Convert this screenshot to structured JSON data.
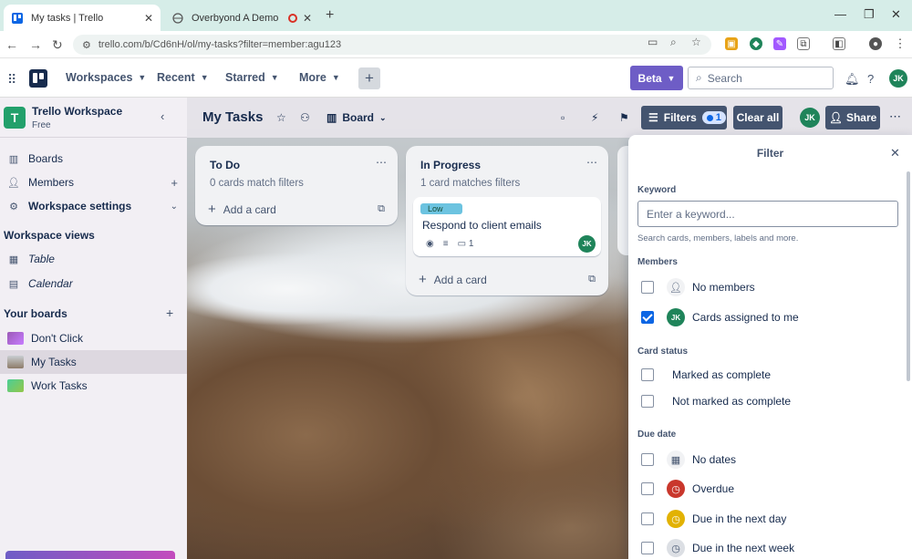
{
  "browser": {
    "tabs": [
      {
        "title": "My tasks | Trello",
        "active": true
      },
      {
        "title": "Overbyond A Demo",
        "active": false
      }
    ],
    "url_prefix": "trello.com",
    "url_path": "/b/Cd6nH/ol/my-tasks?filter=member:agu123"
  },
  "header": {
    "menus": [
      "Workspaces",
      "Recent",
      "Starred",
      "More"
    ],
    "beta_label": "Beta",
    "search_placeholder": "Search",
    "avatar_initials": "JK"
  },
  "sidebar": {
    "workspace_initial": "T",
    "workspace_name": "Trello Workspace",
    "workspace_plan": "Free",
    "nav": [
      {
        "label": "Boards",
        "icon": "boards-icon"
      },
      {
        "label": "Members",
        "icon": "member-icon"
      },
      {
        "label": "Workspace settings",
        "icon": "gear-icon"
      }
    ],
    "views_title": "Workspace views",
    "views": [
      {
        "label": "Table",
        "icon": "table-icon"
      },
      {
        "label": "Calendar",
        "icon": "calendar-icon"
      }
    ],
    "boards_title": "Your boards",
    "boards": [
      {
        "label": "Don't Click",
        "color": "#9b59b6"
      },
      {
        "label": "My Tasks",
        "color": "#8d7b68",
        "selected": true
      },
      {
        "label": "Work Tasks",
        "color": "#4bce97"
      }
    ]
  },
  "board": {
    "title": "My Tasks",
    "view_label": "Board",
    "filters_label": "Filters",
    "filters_count": "1",
    "clear_all_label": "Clear all",
    "share_label": "Share",
    "lists": [
      {
        "title": "To Do",
        "subtitle": "0 cards match filters",
        "add_label": "Add a card"
      },
      {
        "title": "In Progress",
        "subtitle": "1 card matches filters",
        "add_label": "Add a card",
        "card": {
          "label": "Low",
          "title": "Respond to client emails",
          "comments": "1",
          "member": "JK"
        }
      }
    ]
  },
  "filter_panel": {
    "title": "Filter",
    "keyword_section": "Keyword",
    "keyword_placeholder": "Enter a keyword...",
    "keyword_help": "Search cards, members, labels and more.",
    "members_section": "Members",
    "members": [
      {
        "label": "No members",
        "checked": false
      },
      {
        "label": "Cards assigned to me",
        "checked": true
      }
    ],
    "status_section": "Card status",
    "status": [
      {
        "label": "Marked as complete",
        "checked": false
      },
      {
        "label": "Not marked as complete",
        "checked": false
      }
    ],
    "due_section": "Due date",
    "due": [
      {
        "label": "No dates",
        "checked": false,
        "color": "#e9ecef"
      },
      {
        "label": "Overdue",
        "checked": false,
        "color": "#c9372c"
      },
      {
        "label": "Due in the next day",
        "checked": false,
        "color": "#e2b203"
      },
      {
        "label": "Due in the next week",
        "checked": false,
        "color": "#dcdfe4"
      }
    ]
  }
}
